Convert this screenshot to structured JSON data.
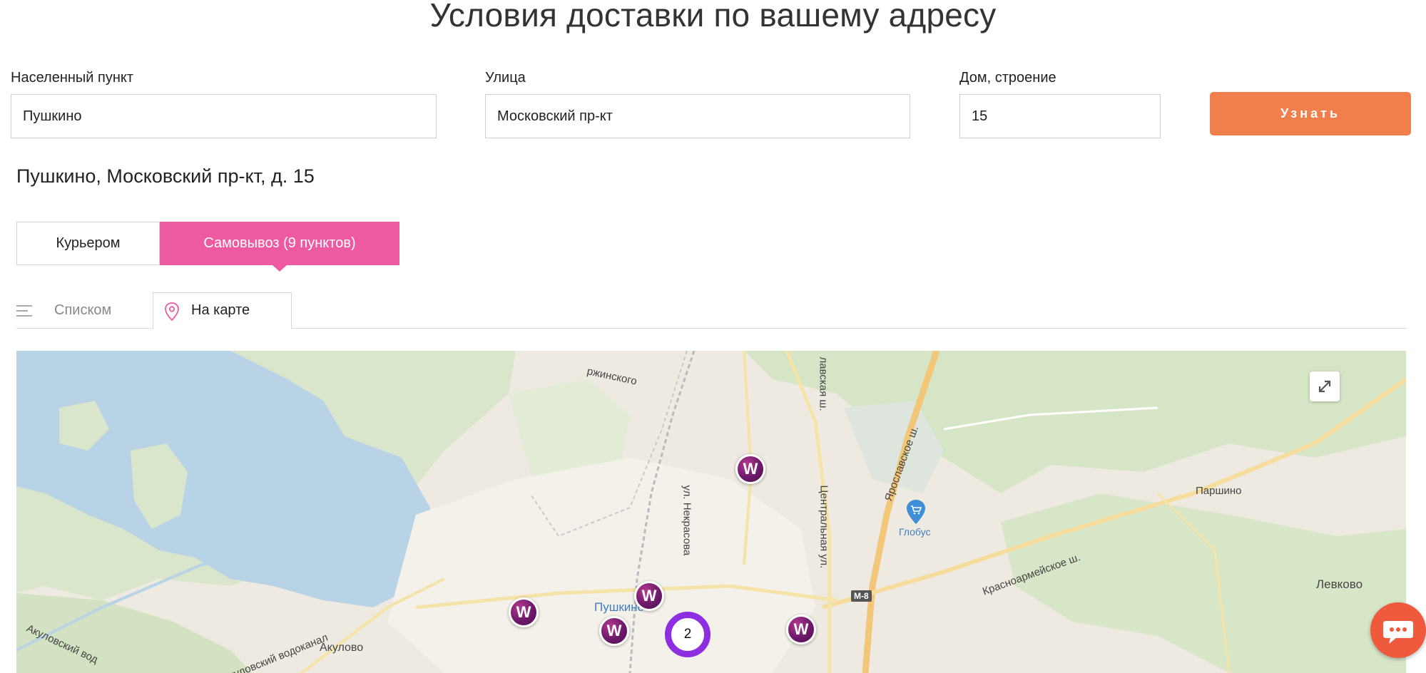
{
  "page": {
    "title": "Условия доставки по вашему адресу"
  },
  "form": {
    "city_label": "Населенный пункт",
    "city_value": "Пушкино",
    "street_label": "Улица",
    "street_value": "Московский пр-кт",
    "house_label": "Дом, строение",
    "house_value": "15",
    "submit_label": "Узнать"
  },
  "result": {
    "address": "Пушкино, Московский пр-кт, д. 15"
  },
  "delivery_tabs": {
    "courier": "Курьером",
    "pickup": "Самовывоз (9 пунктов)",
    "active": "pickup"
  },
  "view_tabs": {
    "list": "Списком",
    "map": "На карте",
    "active": "map"
  },
  "map": {
    "cluster_count": "2",
    "marker_letter": "W",
    "labels": {
      "dzerzhinsky": "ржинского",
      "yaroslav_st": "лавская ш.",
      "yaroslavskoe": "Ярославское ш.",
      "tsentralnaya": "Центральная ул.",
      "nekrasova": "ул. Некрасова",
      "pushkino": "Пушкино",
      "globus": "Глобус",
      "krasnoarm": "Красноармейское ш.",
      "parshino": "Паршино",
      "levkovo": "Левково",
      "akulovo": "Акулово",
      "akul_vod": "Акуловский водоканал",
      "akul_vod2": "Акуловский вод",
      "m8": "М-8"
    }
  },
  "colors": {
    "accent_orange": "#f07f4b",
    "accent_pink": "#ee5aa1",
    "cluster_purple": "#8d2fe0",
    "chat_red": "#f05a3c",
    "water": "#b9d3e6"
  },
  "icons": {
    "list": "list-icon",
    "map": "map-pin-icon",
    "fullscreen": "fullscreen-icon",
    "chat": "chat-icon",
    "store": "cart-pin-icon"
  }
}
